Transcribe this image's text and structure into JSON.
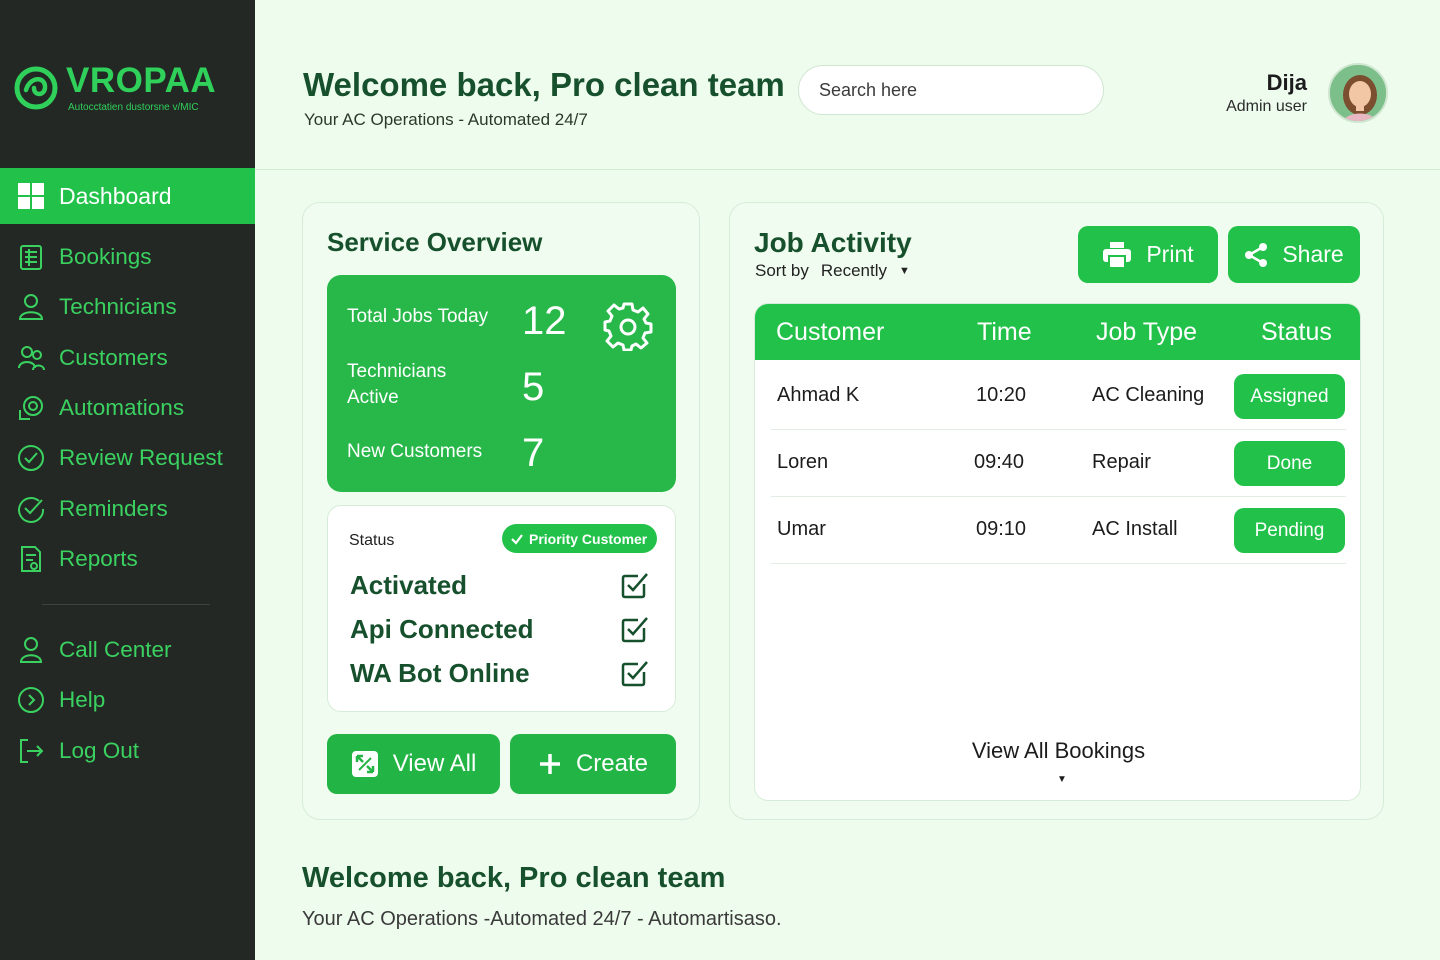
{
  "brand": {
    "name": "VROPAA",
    "tagline": "Autocctatien dustorsne v/MIC",
    "accent_color": "#22c24a",
    "sidebar_color": "#232824"
  },
  "sidebar": {
    "active_item": {
      "label": "Dashboard",
      "icon": "dashboard-grid-icon"
    },
    "items": [
      {
        "label": "Bookings",
        "icon": "bookings-icon"
      },
      {
        "label": "Technicians",
        "icon": "technician-icon"
      },
      {
        "label": "Customers",
        "icon": "customers-icon"
      },
      {
        "label": "Automations",
        "icon": "automations-icon"
      },
      {
        "label": "Review Request",
        "icon": "check-circle-icon"
      },
      {
        "label": "Reminders",
        "icon": "reminder-icon"
      },
      {
        "label": "Reports",
        "icon": "reports-icon"
      }
    ],
    "secondary_items": [
      {
        "label": "Call Center",
        "icon": "user-icon"
      },
      {
        "label": "Help",
        "icon": "chevron-circle-icon"
      },
      {
        "label": "Log Out",
        "icon": "logout-icon"
      }
    ]
  },
  "header": {
    "title": "Welcome back, Pro clean team",
    "subtitle": "Your AC Operations - Automated 24/7",
    "search_placeholder": "Search here",
    "user_name": "Dija",
    "user_role": "Admin user"
  },
  "service_overview": {
    "title": "Service Overview",
    "stats": [
      {
        "label": "Total Jobs Today",
        "value": "12"
      },
      {
        "label": "Technicians Active",
        "value": "5"
      },
      {
        "label": "New Customers",
        "value": "7"
      }
    ],
    "status_label": "Status",
    "badge": "Priority Customer",
    "checks": [
      {
        "label": "Activated",
        "checked": true
      },
      {
        "label": "Api Connected",
        "checked": true
      },
      {
        "label": "WA Bot Online",
        "checked": true
      }
    ],
    "view_all_label": "View All",
    "create_label": "Create"
  },
  "job_activity": {
    "title": "Job Activity",
    "sort_label": "Sort by",
    "sort_value": "Recently",
    "print_label": "Print",
    "share_label": "Share",
    "columns": [
      "Customer",
      "Time",
      "Job Type",
      "Status"
    ],
    "rows": [
      {
        "customer": "Ahmad K",
        "time": "10:20",
        "job_type": "AC Cleaning",
        "status": "Assigned"
      },
      {
        "customer": "Loren",
        "time": "09:40",
        "job_type": "Repair",
        "status": "Done"
      },
      {
        "customer": "Umar",
        "time": "09:10",
        "job_type": "AC Install",
        "status": "Pending"
      }
    ],
    "view_all_bookings": "View All Bookings"
  },
  "footer": {
    "title": "Welcome back, Pro clean team",
    "subtitle": "Your AC Operations -Automated 24/7 - Automartisaso."
  }
}
